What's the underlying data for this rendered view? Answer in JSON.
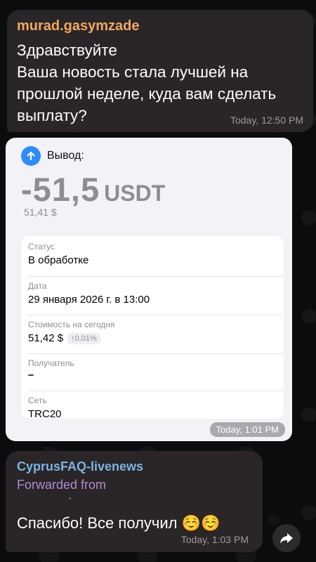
{
  "message_1": {
    "sender": "murad.gasymzade",
    "lines": [
      "Здравствуйте",
      "Ваша новость стала лучшей на",
      "прошлой неделе, куда вам сделать",
      "выплату?"
    ],
    "time": "Today, 12:50 PM"
  },
  "image_message": {
    "withdraw_label": "Вывод:",
    "amount": "-51,5",
    "currency": "USDT",
    "fiat_value": "51,41 $",
    "fields": {
      "status_label": "Статус",
      "status_value": "В обработке",
      "date_label": "Дата",
      "date_value": "29 января 2026 г. в 13:00",
      "cost_label": "Стоимость на сегодня",
      "cost_value": "51,42 $",
      "cost_change": "↑0,01%",
      "recipient_label": "Получатель",
      "network_label": "Сеть",
      "network_value": "TRC20"
    },
    "time": "Today, 1:01 PM"
  },
  "message_3": {
    "sender": "CyprusFAQ-livenews",
    "forwarded": "Forwarded from",
    "text": "Спасибо! Все получил ☺️☺️",
    "time": "Today, 1:03 PM"
  },
  "icons": {
    "withdraw": "arrow-up-circle-icon",
    "share": "share-forward-icon"
  },
  "colors": {
    "background": "#0b0c0e",
    "bubble": "#2a2526",
    "sender_1": "#f0a761",
    "sender_3": "#79b5e6",
    "forwarded": "#b28ad6",
    "accent_blue": "#2c8cff"
  }
}
